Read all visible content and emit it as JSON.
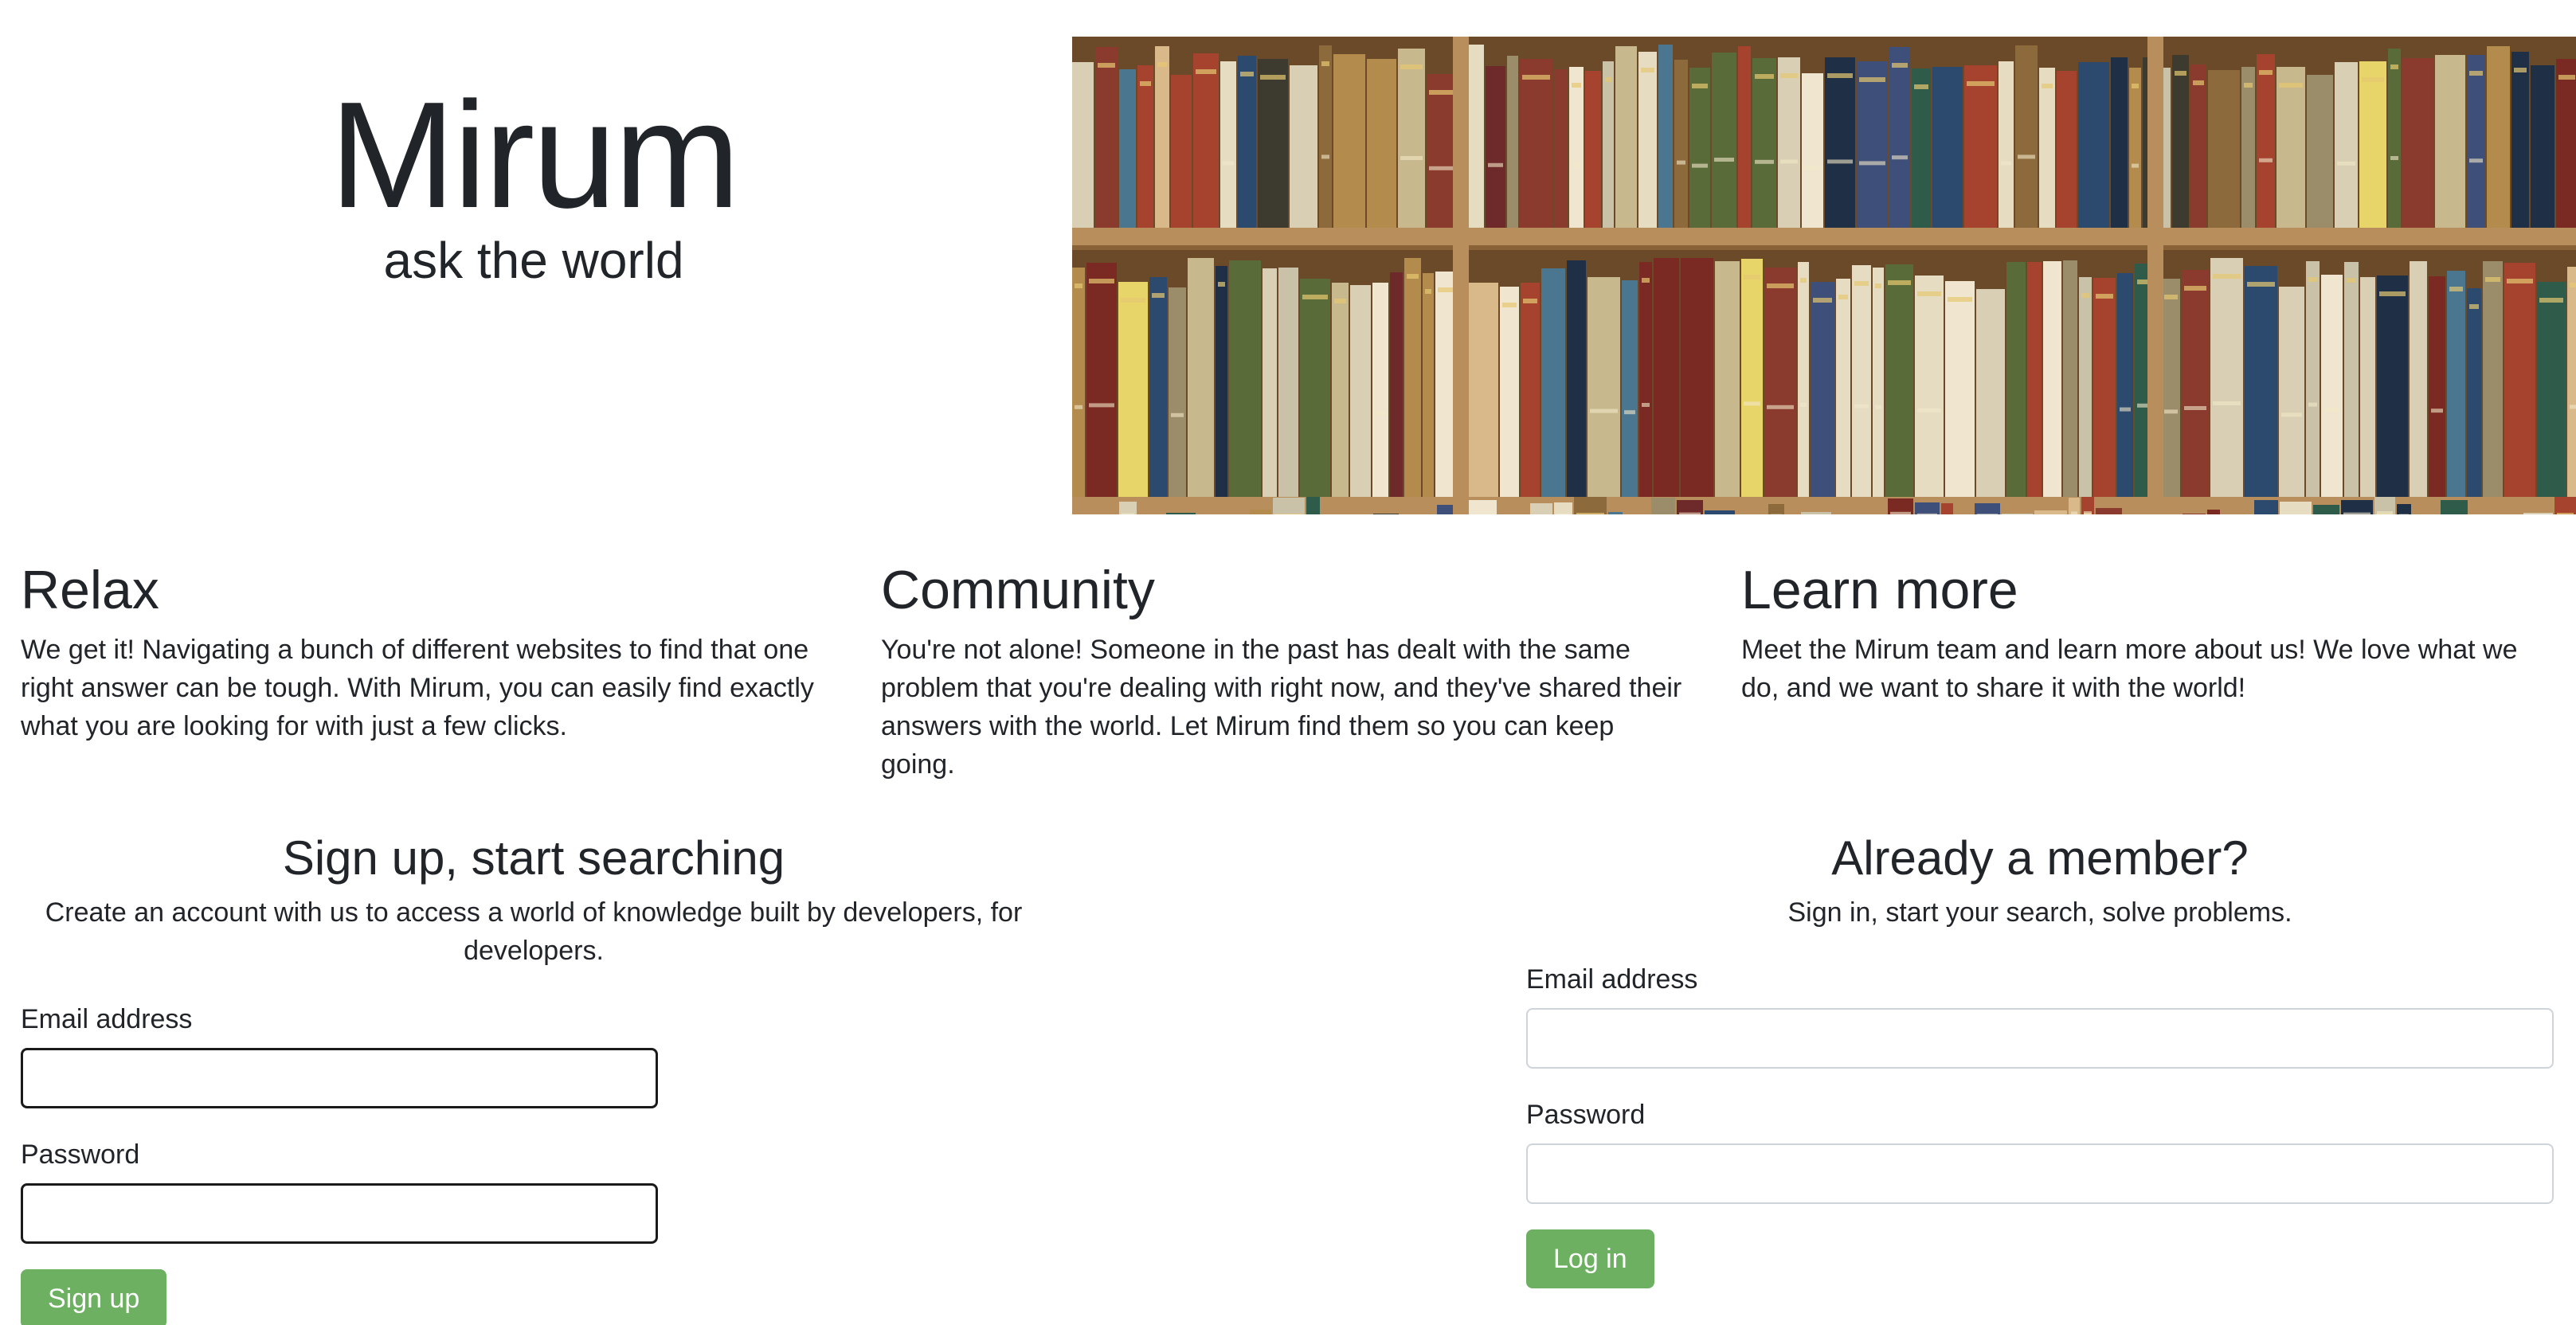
{
  "hero": {
    "title": "Mirum",
    "tagline": "ask the world"
  },
  "features": [
    {
      "heading": "Relax",
      "body": "We get it! Navigating a bunch of different websites to find that one right answer can be tough. With Mirum, you can easily find exactly what you are looking for with just a few clicks."
    },
    {
      "heading": "Community",
      "body": "You're not alone! Someone in the past has dealt with the same problem that you're dealing with right now, and they've shared their answers with the world. Let Mirum find them so you can keep going."
    },
    {
      "heading": "Learn more",
      "body": "Meet the Mirum team and learn more about us! We love what we do, and we want to share it with the world!"
    }
  ],
  "signup": {
    "heading": "Sign up, start searching",
    "lead": "Create an account with us to access a world of knowledge built by developers, for developers.",
    "email_label": "Email address",
    "email_value": "",
    "password_label": "Password",
    "password_value": "",
    "button_label": "Sign up"
  },
  "login": {
    "heading": "Already a member?",
    "lead": "Sign in, start your search, solve problems.",
    "email_label": "Email address",
    "email_value": "",
    "password_label": "Password",
    "password_value": "",
    "button_label": "Log in"
  },
  "colors": {
    "button_green": "#6db062",
    "text": "#212529"
  }
}
